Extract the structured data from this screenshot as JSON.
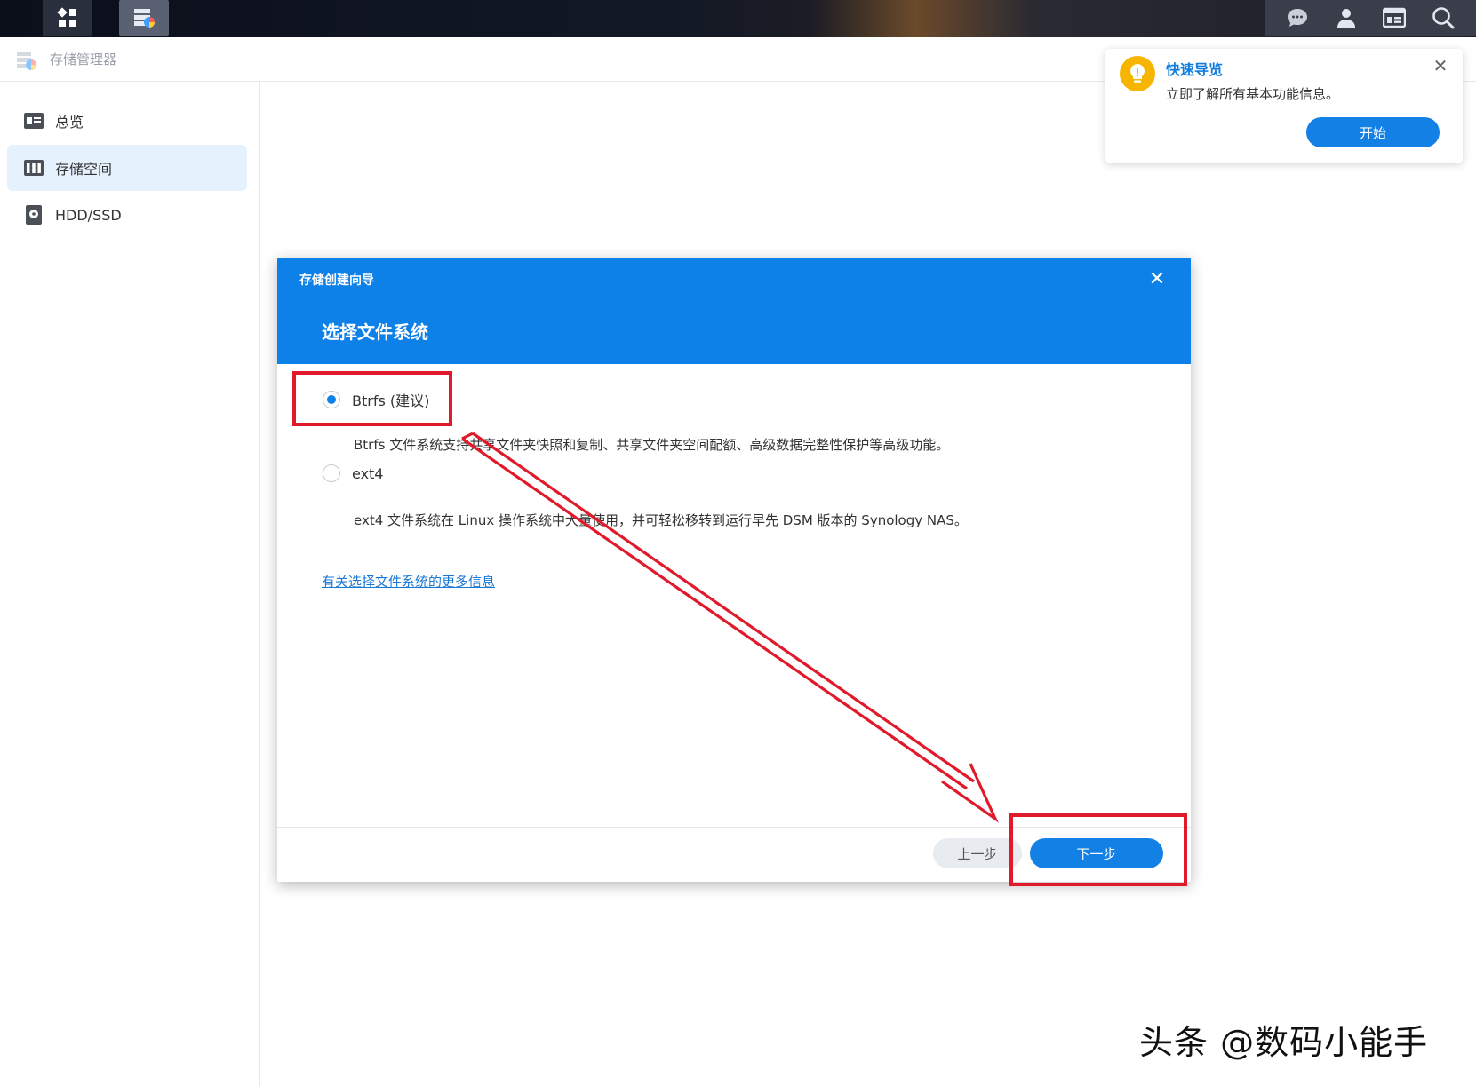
{
  "app": {
    "title": "存储管理器"
  },
  "sidebar": {
    "items": [
      {
        "label": "总览",
        "icon": "overview-icon"
      },
      {
        "label": "存储空间",
        "icon": "storage-pool-icon",
        "active": true
      },
      {
        "label": "HDD/SSD",
        "icon": "disk-icon"
      }
    ]
  },
  "quicknav": {
    "title": "快速导览",
    "description": "立即了解所有基本功能信息。",
    "start_label": "开始"
  },
  "dialog": {
    "wizard_title": "存储创建向导",
    "heading": "选择文件系统",
    "options": [
      {
        "label": "Btrfs (建议)",
        "description": "Btrfs 文件系统支持共享文件夹快照和复制、共享文件夹空间配额、高级数据完整性保护等高级功能。",
        "selected": true
      },
      {
        "label": "ext4",
        "description": "ext4 文件系统在 Linux 操作系统中大量使用，并可轻松移转到运行早先 DSM 版本的 Synology NAS。",
        "selected": false
      }
    ],
    "more_info_link": "有关选择文件系统的更多信息",
    "prev_label": "上一步",
    "next_label": "下一步"
  },
  "watermark": "头条 @数码小能手",
  "colors": {
    "accent": "#0d81e8",
    "button": "#1380e6",
    "annotation": "#e0192b",
    "bulb": "#f7b500"
  }
}
